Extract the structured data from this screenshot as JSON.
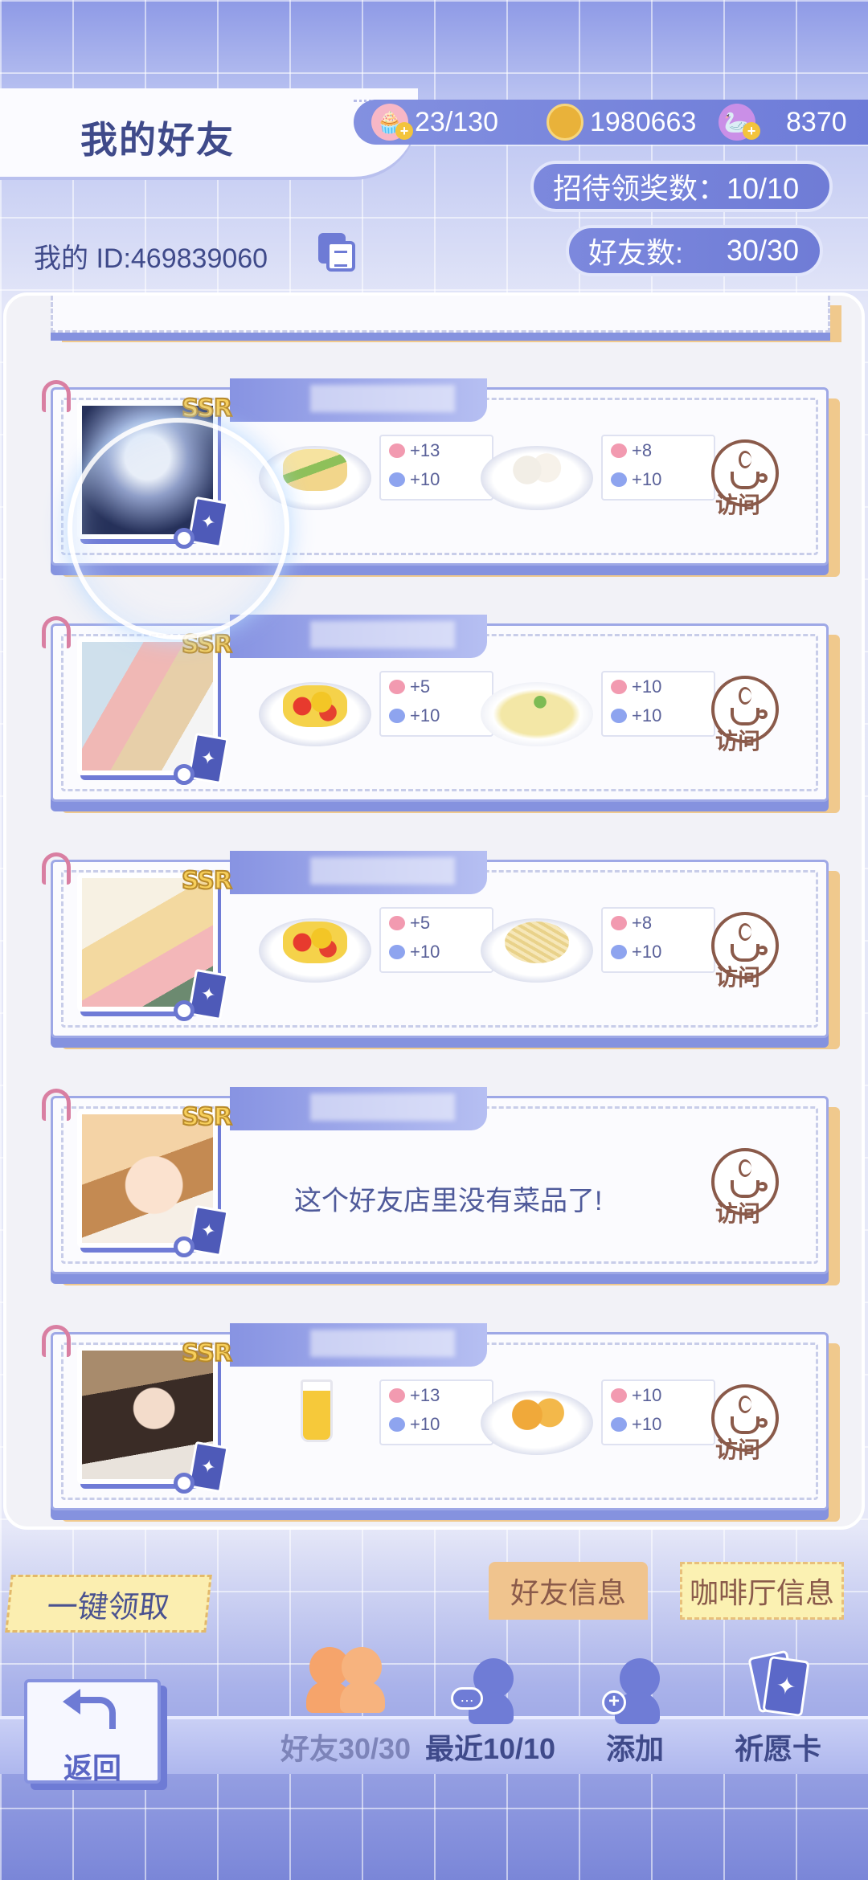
{
  "header": {
    "title": "我的好友",
    "resources": [
      {
        "icon": "cake-icon",
        "value": "23/130"
      },
      {
        "icon": "coin-icon",
        "value": "1980663"
      },
      {
        "icon": "gem-icon",
        "value": "8370"
      }
    ],
    "reward_count_label": "招待领奖数：10/10",
    "friend_count_label": "好友数:",
    "friend_count_value": "30/30",
    "my_id": "我的 ID:469839060"
  },
  "colors": {
    "accent": "#7c88dd",
    "visit_brown": "#8a5a4a",
    "card_border": "#9ea8e6"
  },
  "friends": [
    {
      "rarity": "SSR",
      "dishes": [
        {
          "icon": "sandwich-icon",
          "bonus1": "+13",
          "bonus2": "+10"
        },
        {
          "icon": "dumpling-icon",
          "bonus1": "+8",
          "bonus2": "+10"
        }
      ],
      "visit_label": "访问"
    },
    {
      "rarity": "SSR",
      "dishes": [
        {
          "icon": "tomato-egg-icon",
          "bonus1": "+5",
          "bonus2": "+10"
        },
        {
          "icon": "soup-icon",
          "bonus1": "+10",
          "bonus2": "+10"
        }
      ],
      "visit_label": "访问"
    },
    {
      "rarity": "SSR",
      "dishes": [
        {
          "icon": "tomato-egg-icon",
          "bonus1": "+5",
          "bonus2": "+10"
        },
        {
          "icon": "pasta-icon",
          "bonus1": "+8",
          "bonus2": "+10"
        }
      ],
      "visit_label": "访问"
    },
    {
      "rarity": "SSR",
      "empty_message": "这个好友店里没有菜品了!",
      "visit_label": "访问"
    },
    {
      "rarity": "SSR",
      "dishes": [
        {
          "icon": "juice-icon",
          "bonus1": "+13",
          "bonus2": "+10"
        },
        {
          "icon": "egg-tart-icon",
          "bonus1": "+10",
          "bonus2": "+10"
        }
      ],
      "visit_label": "访问"
    }
  ],
  "actions": {
    "claim_all": "一键领取",
    "friend_info_tab": "好友信息",
    "cafe_info_tab": "咖啡厅信息"
  },
  "bottom_nav": {
    "back": "返回",
    "friends": "好友30/30",
    "recent": "最近10/10",
    "add": "添加",
    "wish_card": "祈愿卡"
  }
}
